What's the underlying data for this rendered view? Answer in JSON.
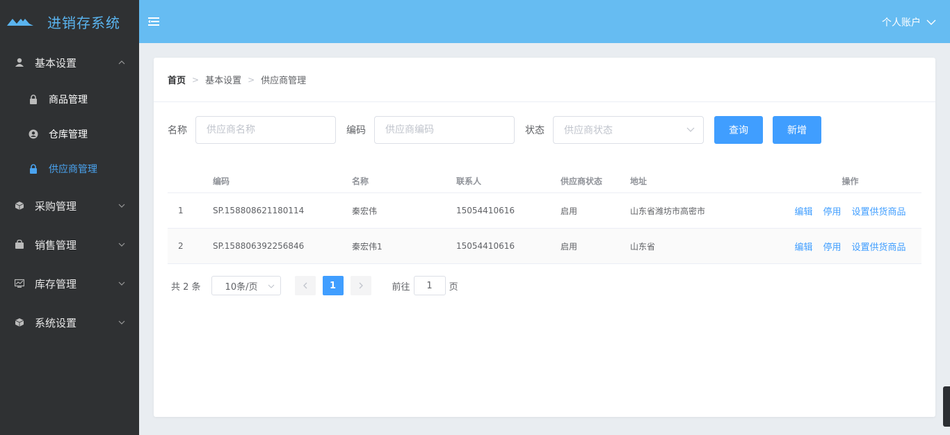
{
  "app": {
    "title": "进销存系统"
  },
  "colors": {
    "header": "#66bcf2",
    "sidebar": "#2f3133",
    "accent": "#409eff",
    "active_menu": "#4aa4f1"
  },
  "sidebar": {
    "groups": [
      {
        "label": "基本设置",
        "icon": "user-icon",
        "expanded": true,
        "children": [
          {
            "label": "商品管理",
            "icon": "lock-icon",
            "active": false
          },
          {
            "label": "仓库管理",
            "icon": "user-circle-icon",
            "active": false
          },
          {
            "label": "供应商管理",
            "icon": "lock-icon",
            "active": true
          }
        ]
      },
      {
        "label": "采购管理",
        "icon": "box-icon",
        "expanded": false
      },
      {
        "label": "销售管理",
        "icon": "bag-icon",
        "expanded": false
      },
      {
        "label": "库存管理",
        "icon": "chart-icon",
        "expanded": false
      },
      {
        "label": "系统设置",
        "icon": "box-icon",
        "expanded": false
      }
    ]
  },
  "header": {
    "account_label": "个人账户"
  },
  "breadcrumb": [
    "首页",
    "基本设置",
    "供应商管理"
  ],
  "filters": {
    "name_label": "名称",
    "name_placeholder": "供应商名称",
    "code_label": "编码",
    "code_placeholder": "供应商编码",
    "status_label": "状态",
    "status_placeholder": "供应商状态",
    "query_button": "查询",
    "add_button": "新增"
  },
  "table": {
    "columns": [
      "",
      "编码",
      "名称",
      "联系人",
      "供应商状态",
      "地址",
      "操作"
    ],
    "rows": [
      {
        "index": "1",
        "code": "SP.158808621180114",
        "name": "秦宏伟",
        "contact": "15054410616",
        "status": "启用",
        "address": "山东省潍坊市高密市"
      },
      {
        "index": "2",
        "code": "SP.158806392256846",
        "name": "秦宏伟1",
        "contact": "15054410616",
        "status": "启用",
        "address": "山东省"
      }
    ],
    "actions": {
      "edit": "编辑",
      "disable": "停用",
      "set_goods": "设置供货商品"
    }
  },
  "pagination": {
    "total_text": "共 2 条",
    "page_size": "10条/页",
    "current_page": "1",
    "goto_label": "前往",
    "goto_value": "1",
    "page_suffix": "页"
  }
}
